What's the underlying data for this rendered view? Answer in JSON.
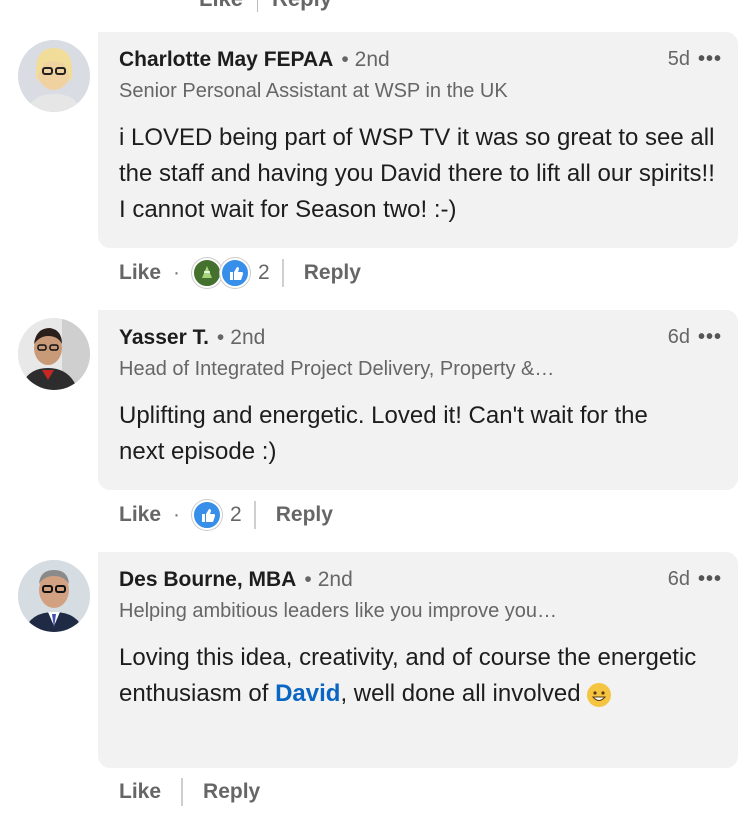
{
  "top_actions": {
    "like": "Like",
    "reply": "Reply"
  },
  "comments": [
    {
      "name": "Charlotte May FEPAA",
      "degree": "2nd",
      "headline": "Senior Personal Assistant at WSP in the UK",
      "time": "5d",
      "more": "•••",
      "body": "i LOVED being part of WSP TV it was so great to see all the staff and having you David there to lift all our spirits!! I cannot wait for Season two! :-)",
      "like": "Like",
      "reaction_count": "2",
      "reply": "Reply"
    },
    {
      "name": "Yasser T.",
      "degree": "2nd",
      "headline": "Head of Integrated Project Delivery, Property &…",
      "time": "6d",
      "more": "•••",
      "body": "Uplifting and energetic. Loved it! Can't wait for the next episode :)",
      "like": "Like",
      "reaction_count": "2",
      "reply": "Reply"
    },
    {
      "name": "Des Bourne, MBA",
      "degree": "2nd",
      "headline": "Helping ambitious leaders like you improve you…",
      "time": "6d",
      "more": "•••",
      "body_before": "Loving this idea, creativity, and of course the energetic enthusiasm of ",
      "mention": "David",
      "body_after": ", well done all involved ",
      "like": "Like",
      "reply": "Reply"
    }
  ],
  "colors": {
    "bubble": "#f2f2f2",
    "mention": "#0a66c2",
    "like_reaction": "#378fe9",
    "celebrate_reaction": "#44712e"
  }
}
